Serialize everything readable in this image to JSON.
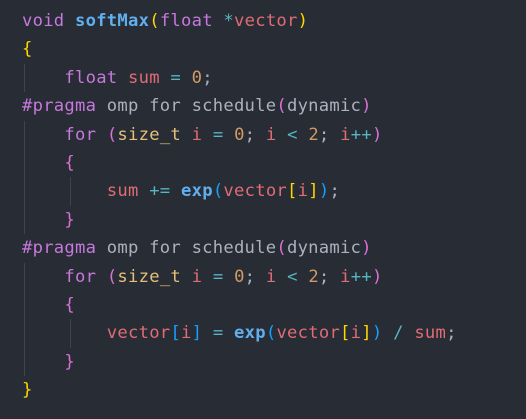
{
  "colors": {
    "background": "#282c34",
    "keyword": "#c678dd",
    "function": "#61afef",
    "variable": "#e06c75",
    "number": "#d19a66",
    "type": "#e5c07b",
    "operator": "#56b6c2",
    "plain": "#abb2bf",
    "bracket_level_1": "#ffd700",
    "bracket_level_2": "#da70d6",
    "bracket_level_3": "#179fff"
  },
  "code": {
    "lines": [
      {
        "tokens": [
          {
            "t": "void",
            "c": "kw"
          },
          {
            "t": " ",
            "c": "pl"
          },
          {
            "t": "softMax",
            "c": "fn"
          },
          {
            "t": "(",
            "c": "b1"
          },
          {
            "t": "float",
            "c": "kw"
          },
          {
            "t": " ",
            "c": "pl"
          },
          {
            "t": "*",
            "c": "op"
          },
          {
            "t": "vector",
            "c": "var"
          },
          {
            "t": ")",
            "c": "b1"
          }
        ]
      },
      {
        "tokens": [
          {
            "t": "{",
            "c": "b1"
          }
        ]
      },
      {
        "tokens": [
          {
            "t": "    ",
            "c": "pl"
          },
          {
            "t": "float",
            "c": "kw"
          },
          {
            "t": " ",
            "c": "pl"
          },
          {
            "t": "sum",
            "c": "var"
          },
          {
            "t": " ",
            "c": "pl"
          },
          {
            "t": "=",
            "c": "op"
          },
          {
            "t": " ",
            "c": "pl"
          },
          {
            "t": "0",
            "c": "num"
          },
          {
            "t": ";",
            "c": "pl"
          }
        ]
      },
      {
        "tokens": [
          {
            "t": "#pragma",
            "c": "pp"
          },
          {
            "t": " omp for schedule",
            "c": "ppt"
          },
          {
            "t": "(",
            "c": "b2"
          },
          {
            "t": "dynamic",
            "c": "ppt"
          },
          {
            "t": ")",
            "c": "b2"
          }
        ]
      },
      {
        "tokens": [
          {
            "t": "    ",
            "c": "pl"
          },
          {
            "t": "for",
            "c": "kw"
          },
          {
            "t": " ",
            "c": "pl"
          },
          {
            "t": "(",
            "c": "b2"
          },
          {
            "t": "size_t",
            "c": "type"
          },
          {
            "t": " ",
            "c": "pl"
          },
          {
            "t": "i",
            "c": "var"
          },
          {
            "t": " ",
            "c": "pl"
          },
          {
            "t": "=",
            "c": "op"
          },
          {
            "t": " ",
            "c": "pl"
          },
          {
            "t": "0",
            "c": "num"
          },
          {
            "t": "; ",
            "c": "pl"
          },
          {
            "t": "i",
            "c": "var"
          },
          {
            "t": " ",
            "c": "pl"
          },
          {
            "t": "<",
            "c": "op"
          },
          {
            "t": " ",
            "c": "pl"
          },
          {
            "t": "2",
            "c": "num"
          },
          {
            "t": "; ",
            "c": "pl"
          },
          {
            "t": "i",
            "c": "var"
          },
          {
            "t": "++",
            "c": "op"
          },
          {
            "t": ")",
            "c": "b2"
          }
        ]
      },
      {
        "tokens": [
          {
            "t": "    ",
            "c": "pl"
          },
          {
            "t": "{",
            "c": "b2"
          }
        ]
      },
      {
        "tokens": [
          {
            "t": "        ",
            "c": "pl"
          },
          {
            "t": "sum",
            "c": "var"
          },
          {
            "t": " ",
            "c": "pl"
          },
          {
            "t": "+=",
            "c": "op"
          },
          {
            "t": " ",
            "c": "pl"
          },
          {
            "t": "exp",
            "c": "fn"
          },
          {
            "t": "(",
            "c": "b3"
          },
          {
            "t": "vector",
            "c": "var"
          },
          {
            "t": "[",
            "c": "b1"
          },
          {
            "t": "i",
            "c": "var"
          },
          {
            "t": "]",
            "c": "b1"
          },
          {
            "t": ")",
            "c": "b3"
          },
          {
            "t": ";",
            "c": "pl"
          }
        ]
      },
      {
        "tokens": [
          {
            "t": "    ",
            "c": "pl"
          },
          {
            "t": "}",
            "c": "b2"
          }
        ]
      },
      {
        "tokens": [
          {
            "t": "#pragma",
            "c": "pp"
          },
          {
            "t": " omp for schedule",
            "c": "ppt"
          },
          {
            "t": "(",
            "c": "b2"
          },
          {
            "t": "dynamic",
            "c": "ppt"
          },
          {
            "t": ")",
            "c": "b2"
          }
        ]
      },
      {
        "tokens": [
          {
            "t": "    ",
            "c": "pl"
          },
          {
            "t": "for",
            "c": "kw"
          },
          {
            "t": " ",
            "c": "pl"
          },
          {
            "t": "(",
            "c": "b2"
          },
          {
            "t": "size_t",
            "c": "type"
          },
          {
            "t": " ",
            "c": "pl"
          },
          {
            "t": "i",
            "c": "var"
          },
          {
            "t": " ",
            "c": "pl"
          },
          {
            "t": "=",
            "c": "op"
          },
          {
            "t": " ",
            "c": "pl"
          },
          {
            "t": "0",
            "c": "num"
          },
          {
            "t": "; ",
            "c": "pl"
          },
          {
            "t": "i",
            "c": "var"
          },
          {
            "t": " ",
            "c": "pl"
          },
          {
            "t": "<",
            "c": "op"
          },
          {
            "t": " ",
            "c": "pl"
          },
          {
            "t": "2",
            "c": "num"
          },
          {
            "t": "; ",
            "c": "pl"
          },
          {
            "t": "i",
            "c": "var"
          },
          {
            "t": "++",
            "c": "op"
          },
          {
            "t": ")",
            "c": "b2"
          }
        ]
      },
      {
        "tokens": [
          {
            "t": "    ",
            "c": "pl"
          },
          {
            "t": "{",
            "c": "b2"
          }
        ]
      },
      {
        "tokens": [
          {
            "t": "        ",
            "c": "pl"
          },
          {
            "t": "vector",
            "c": "var"
          },
          {
            "t": "[",
            "c": "b3"
          },
          {
            "t": "i",
            "c": "var"
          },
          {
            "t": "]",
            "c": "b3"
          },
          {
            "t": " ",
            "c": "pl"
          },
          {
            "t": "=",
            "c": "op"
          },
          {
            "t": " ",
            "c": "pl"
          },
          {
            "t": "exp",
            "c": "fn"
          },
          {
            "t": "(",
            "c": "b3"
          },
          {
            "t": "vector",
            "c": "var"
          },
          {
            "t": "[",
            "c": "b1"
          },
          {
            "t": "i",
            "c": "var"
          },
          {
            "t": "]",
            "c": "b1"
          },
          {
            "t": ")",
            "c": "b3"
          },
          {
            "t": " ",
            "c": "pl"
          },
          {
            "t": "/",
            "c": "op"
          },
          {
            "t": " ",
            "c": "pl"
          },
          {
            "t": "sum",
            "c": "var"
          },
          {
            "t": ";",
            "c": "pl"
          }
        ]
      },
      {
        "tokens": [
          {
            "t": "    ",
            "c": "pl"
          },
          {
            "t": "}",
            "c": "b2"
          }
        ]
      },
      {
        "tokens": [
          {
            "t": "}",
            "c": "b1"
          }
        ]
      }
    ]
  }
}
